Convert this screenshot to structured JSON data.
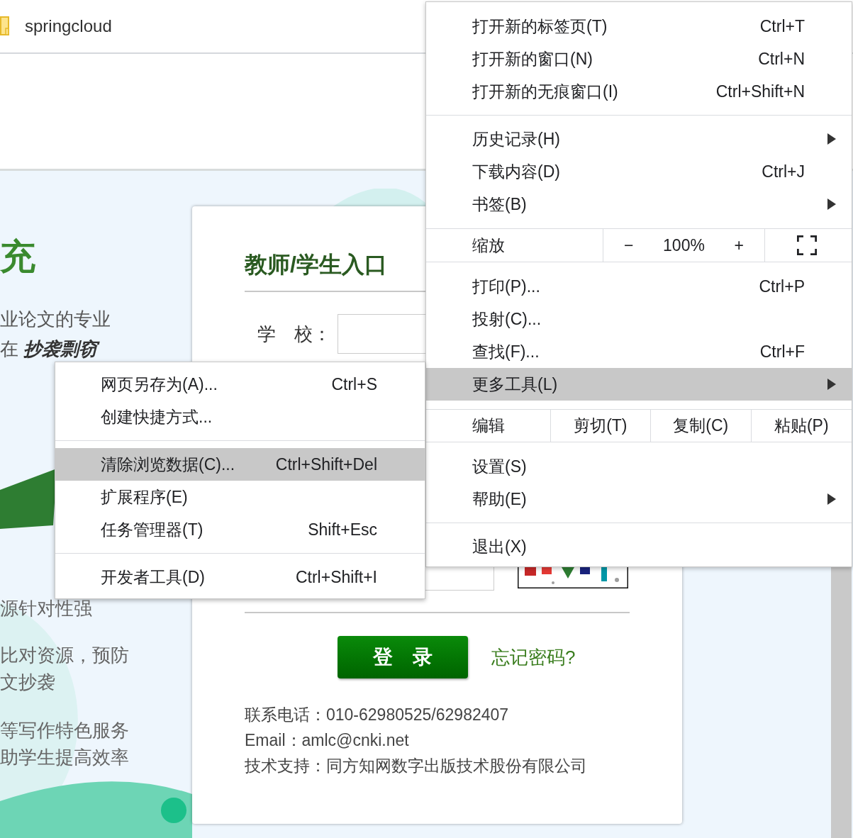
{
  "bookmarks_bar": {
    "items": [
      {
        "label": "springcloud"
      }
    ]
  },
  "page_intro": {
    "heading": "充",
    "lines": [
      "业论文的专业",
      "在 **抄袭剽窃**"
    ],
    "features": [
      "源针对性强",
      "比对资源，预防",
      "文抄袭",
      "等写作特色服务",
      "助学生提高效率"
    ]
  },
  "login_card": {
    "title": "教师/学生入口",
    "school_label": "学　校：",
    "login_button": "登　录",
    "forgot_link": "忘记密码?",
    "contact": [
      "联系电话：010-62980525/62982407",
      "Email：amlc@cnki.net",
      "技术支持：同方知网数字出版技术股份有限公司"
    ]
  },
  "main_menu": {
    "items": [
      {
        "kind": "item",
        "label": "打开新的标签页(T)",
        "shortcut": "Ctrl+T",
        "submenu": false,
        "selected": false
      },
      {
        "kind": "item",
        "label": "打开新的窗口(N)",
        "shortcut": "Ctrl+N",
        "submenu": false,
        "selected": false
      },
      {
        "kind": "item",
        "label": "打开新的无痕窗口(I)",
        "shortcut": "Ctrl+Shift+N",
        "submenu": false,
        "selected": false
      },
      {
        "kind": "separator"
      },
      {
        "kind": "item",
        "label": "历史记录(H)",
        "submenu": true,
        "selected": false
      },
      {
        "kind": "item",
        "label": "下载内容(D)",
        "shortcut": "Ctrl+J",
        "submenu": false,
        "selected": false
      },
      {
        "kind": "item",
        "label": "书签(B)",
        "submenu": true,
        "selected": false
      },
      {
        "kind": "zoom",
        "label": "缩放",
        "minus": "−",
        "value": "100%",
        "plus": "+"
      },
      {
        "kind": "item",
        "label": "打印(P)...",
        "shortcut": "Ctrl+P",
        "submenu": false,
        "selected": false
      },
      {
        "kind": "item",
        "label": "投射(C)...",
        "submenu": false,
        "selected": false
      },
      {
        "kind": "item",
        "label": "查找(F)...",
        "shortcut": "Ctrl+F",
        "submenu": false,
        "selected": false
      },
      {
        "kind": "item",
        "label": "更多工具(L)",
        "submenu": true,
        "selected": true
      },
      {
        "kind": "edit",
        "label": "编辑",
        "actions": [
          "剪切(T)",
          "复制(C)",
          "粘贴(P)"
        ]
      },
      {
        "kind": "item",
        "label": "设置(S)",
        "submenu": false,
        "selected": false
      },
      {
        "kind": "item",
        "label": "帮助(E)",
        "submenu": true,
        "selected": false
      },
      {
        "kind": "separator"
      },
      {
        "kind": "item",
        "label": "退出(X)",
        "submenu": false,
        "selected": false
      }
    ]
  },
  "more_tools_menu": {
    "items": [
      {
        "kind": "item",
        "label": "网页另存为(A)...",
        "shortcut": "Ctrl+S",
        "selected": false
      },
      {
        "kind": "item",
        "label": "创建快捷方式...",
        "selected": false
      },
      {
        "kind": "separator"
      },
      {
        "kind": "item",
        "label": "清除浏览数据(C)...",
        "shortcut": "Ctrl+Shift+Del",
        "selected": true
      },
      {
        "kind": "item",
        "label": "扩展程序(E)",
        "selected": false
      },
      {
        "kind": "item",
        "label": "任务管理器(T)",
        "shortcut": "Shift+Esc",
        "selected": false
      },
      {
        "kind": "separator"
      },
      {
        "kind": "item",
        "label": "开发者工具(D)",
        "shortcut": "Ctrl+Shift+I",
        "selected": false
      }
    ]
  }
}
